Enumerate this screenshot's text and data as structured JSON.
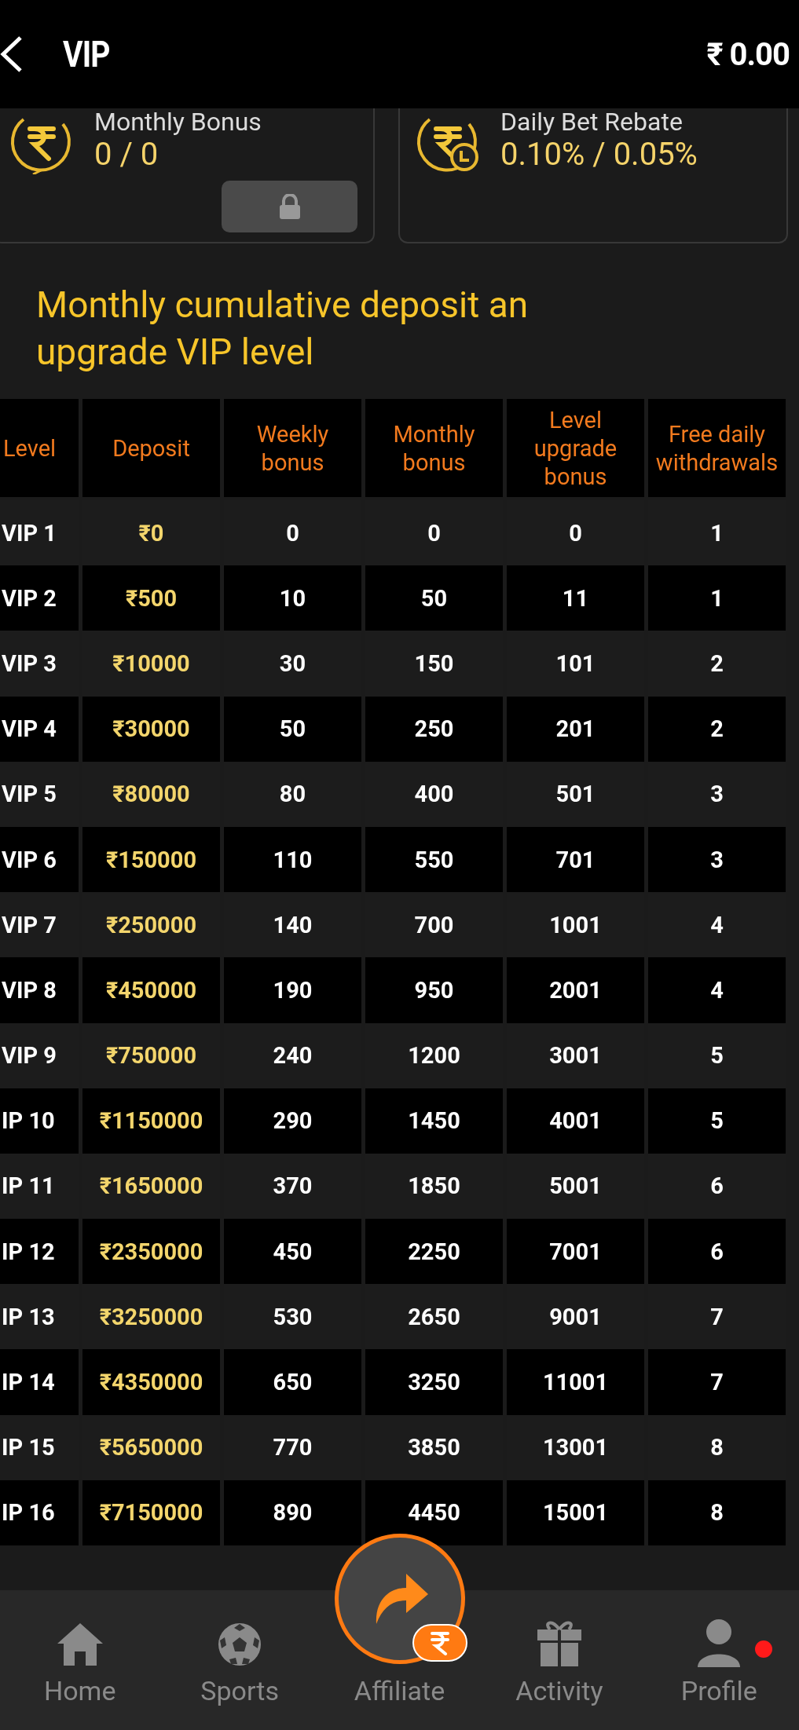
{
  "header": {
    "title": "VIP",
    "balance": "₹ 0.00"
  },
  "cards": [
    {
      "title": "Monthly Bonus",
      "value": "0 / 0",
      "locked": true
    },
    {
      "title": "Daily Bet Rebate",
      "value": "0.10% / 0.05%",
      "locked": false
    }
  ],
  "section_title": "Monthly cumulative deposit an upgrade VIP level",
  "table": {
    "columns": [
      "Level",
      "Deposit",
      "Weekly bonus",
      "Monthly bonus",
      "Level upgrade bonus",
      "Free daily withdrawals"
    ],
    "rows": [
      [
        "VIP 1",
        "₹0",
        "0",
        "0",
        "0",
        "1"
      ],
      [
        "VIP 2",
        "₹500",
        "10",
        "50",
        "11",
        "1"
      ],
      [
        "VIP 3",
        "₹10000",
        "30",
        "150",
        "101",
        "2"
      ],
      [
        "VIP 4",
        "₹30000",
        "50",
        "250",
        "201",
        "2"
      ],
      [
        "VIP 5",
        "₹80000",
        "80",
        "400",
        "501",
        "3"
      ],
      [
        "VIP 6",
        "₹150000",
        "110",
        "550",
        "701",
        "3"
      ],
      [
        "VIP 7",
        "₹250000",
        "140",
        "700",
        "1001",
        "4"
      ],
      [
        "VIP 8",
        "₹450000",
        "190",
        "950",
        "2001",
        "4"
      ],
      [
        "VIP 9",
        "₹750000",
        "240",
        "1200",
        "3001",
        "5"
      ],
      [
        "IP 10",
        "₹1150000",
        "290",
        "1450",
        "4001",
        "5"
      ],
      [
        "IP 11",
        "₹1650000",
        "370",
        "1850",
        "5001",
        "6"
      ],
      [
        "IP 12",
        "₹2350000",
        "450",
        "2250",
        "7001",
        "6"
      ],
      [
        "IP 13",
        "₹3250000",
        "530",
        "2650",
        "9001",
        "7"
      ],
      [
        "IP 14",
        "₹4350000",
        "650",
        "3250",
        "11001",
        "7"
      ],
      [
        "IP 15",
        "₹5650000",
        "770",
        "3850",
        "13001",
        "8"
      ],
      [
        "IP 16",
        "₹7150000",
        "890",
        "4450",
        "15001",
        "8"
      ]
    ]
  },
  "nav": [
    {
      "label": "Home",
      "kind": "plain",
      "notification": false
    },
    {
      "label": "Sports",
      "kind": "plain",
      "notification": false
    },
    {
      "label": "Affiliate",
      "kind": "raised",
      "notification": false
    },
    {
      "label": "Activity",
      "kind": "plain",
      "notification": false
    },
    {
      "label": "Profile",
      "kind": "plain",
      "notification": true
    }
  ]
}
